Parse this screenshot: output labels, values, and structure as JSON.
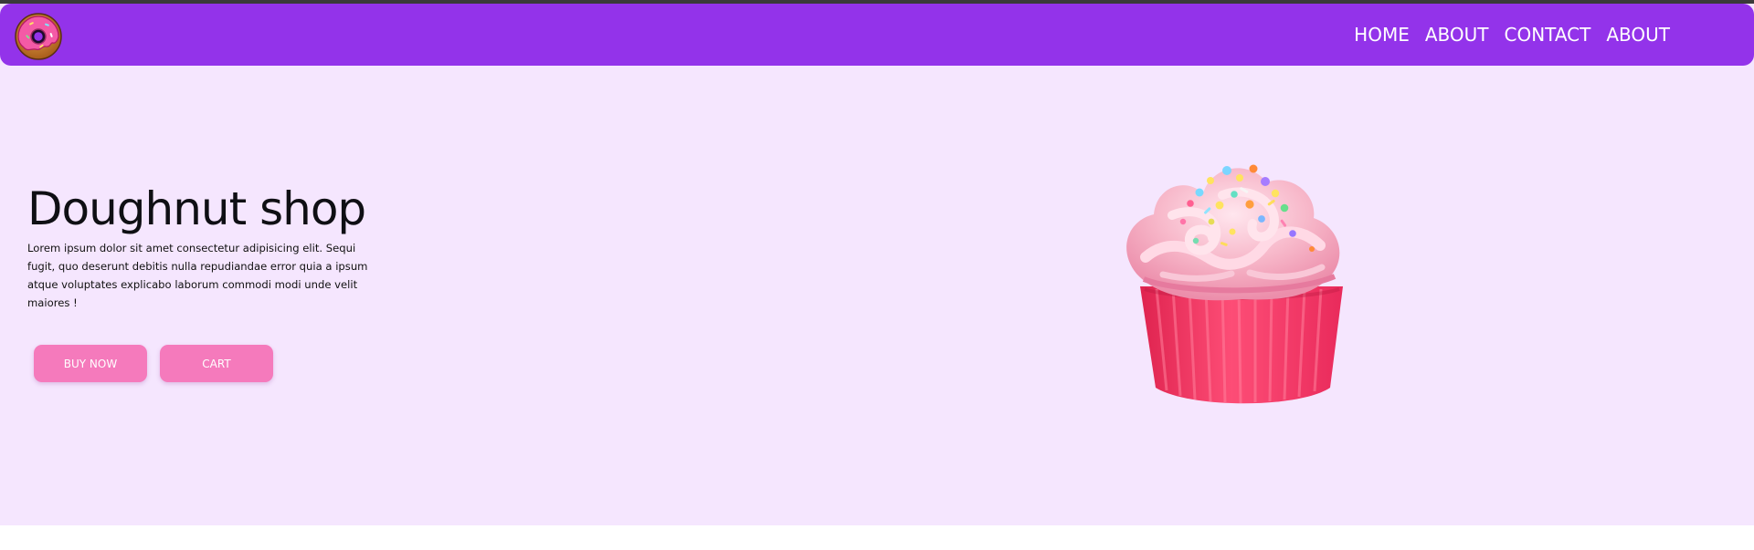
{
  "nav": {
    "logo": "doughnut-logo-icon",
    "links": [
      "HOME",
      "ABOUT",
      "CONTACT",
      "ABOUT"
    ]
  },
  "hero": {
    "title": "Doughnut shop",
    "description": "Lorem ipsum dolor sit amet consectetur adipisicing elit. Sequi fugit, quo deserunt debitis nulla repudiandae error quia a ipsum atque voluptates explicabo laborum commodi modi unde velit maiores !",
    "buttons": {
      "buy_now": "BUY NOW",
      "cart": "CART"
    },
    "image": "cupcake-image"
  },
  "colors": {
    "navbar": "#9333ea",
    "hero_background": "#f5e6fe",
    "button": "#f57abc",
    "title_text": "#0f0f14"
  }
}
